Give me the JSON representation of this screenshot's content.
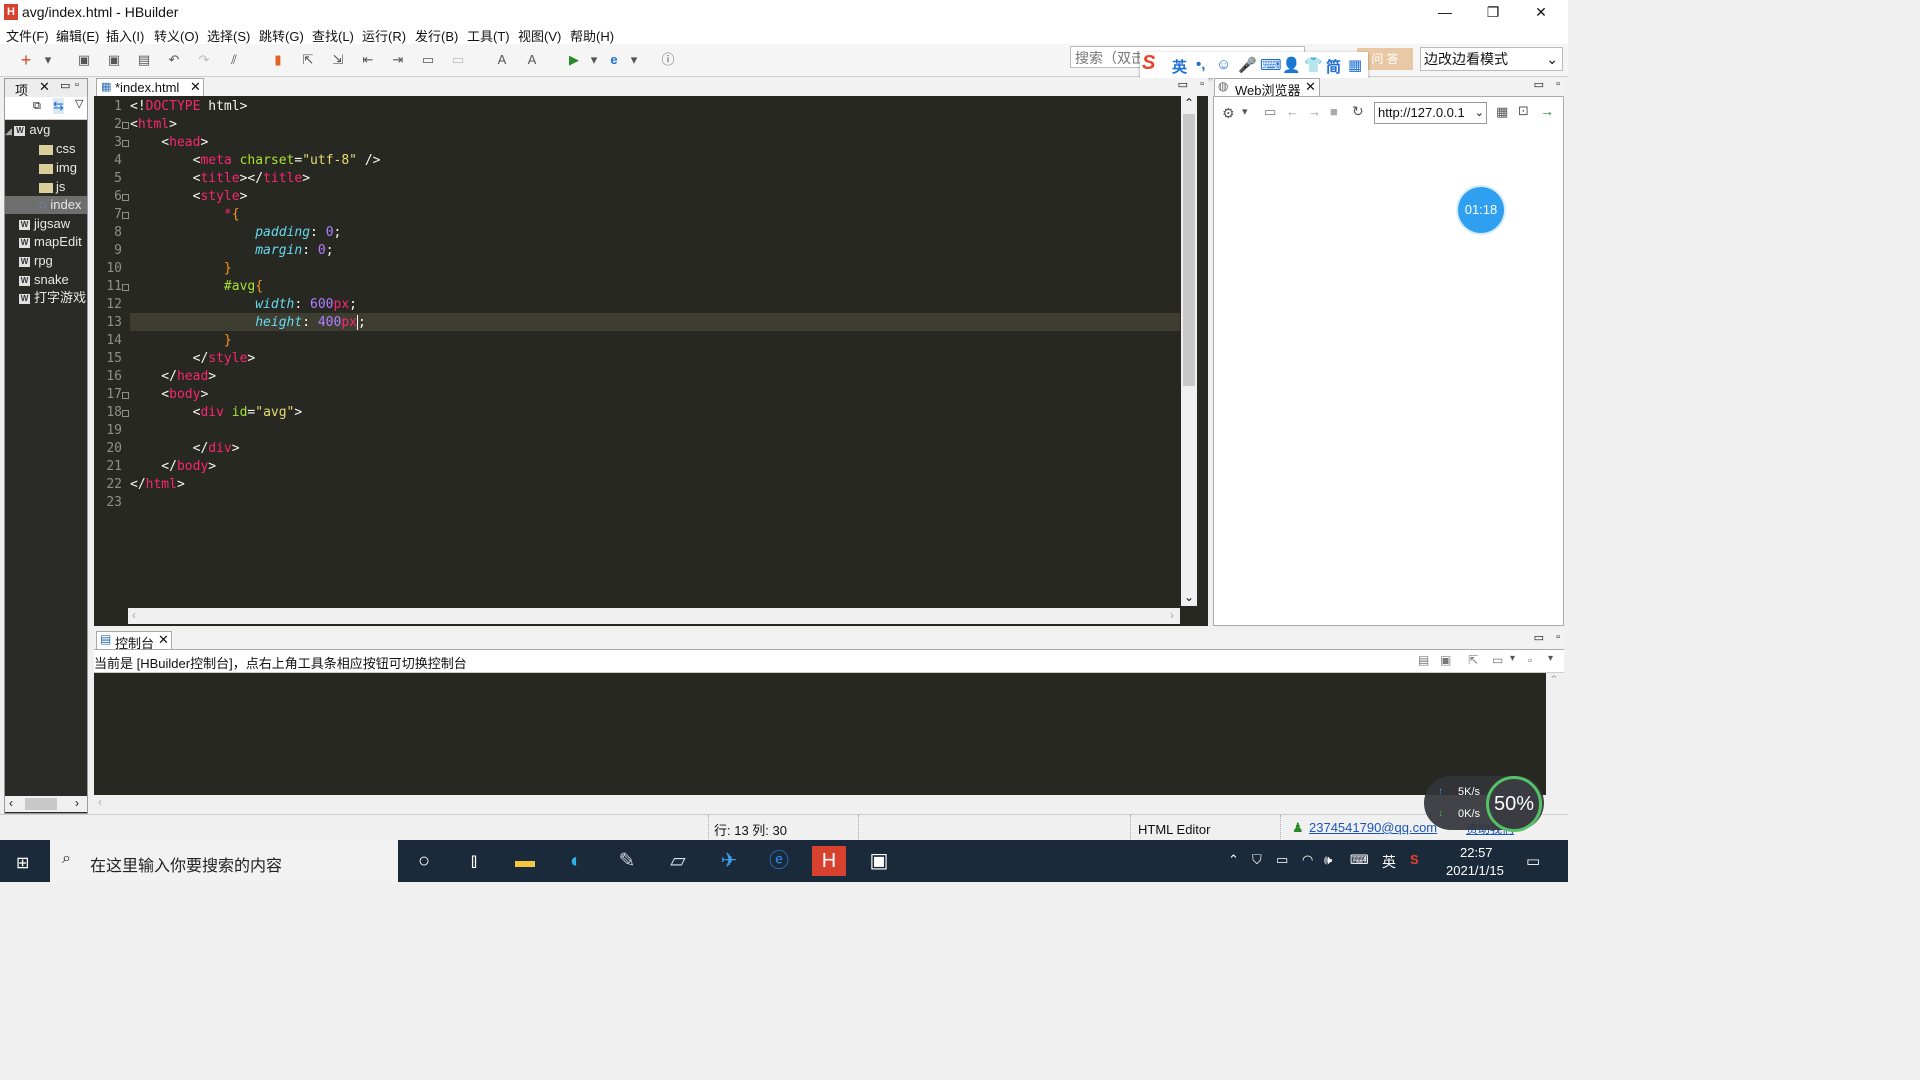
{
  "window": {
    "title": "avg/index.html  -  HBuilder",
    "app_icon": "H",
    "minimize_glyph": "—",
    "restore_glyph": "❐",
    "close_glyph": "✕"
  },
  "menu": [
    "文件(F)",
    "编辑(E)",
    "插入(I)",
    "转义(O)",
    "选择(S)",
    "跳转(G)",
    "查找(L)",
    "运行(R)",
    "发行(B)",
    "工具(T)",
    "视图(V)",
    "帮助(H)"
  ],
  "toolbar": {
    "search_placeholder": "搜索（双击",
    "ime": [
      "S",
      "英",
      "•,",
      "☺",
      "🎤",
      "⌨",
      "👤",
      "👕",
      "简",
      "▦"
    ],
    "help_label": "问 答",
    "mode": "边改边看模式"
  },
  "project": {
    "tab_label": "项",
    "tree": [
      {
        "label": "avg",
        "type": "project"
      },
      {
        "label": "css",
        "type": "folder"
      },
      {
        "label": "img",
        "type": "folder"
      },
      {
        "label": "js",
        "type": "folder"
      },
      {
        "label": "index",
        "type": "file",
        "selected": true
      },
      {
        "label": "jigsaw",
        "type": "project"
      },
      {
        "label": "mapEdit",
        "type": "project"
      },
      {
        "label": "rpg",
        "type": "project"
      },
      {
        "label": "snake",
        "type": "project"
      },
      {
        "label": "打字游戏",
        "type": "project"
      }
    ]
  },
  "editor": {
    "tab_label": "*index.html",
    "line_numbers": [
      "1",
      "2",
      "3",
      "4",
      "5",
      "6",
      "7",
      "8",
      "9",
      "10",
      "11",
      "12",
      "13",
      "14",
      "15",
      "16",
      "17",
      "18",
      "19",
      "20",
      "21",
      "22",
      "23"
    ],
    "current_line": 13
  },
  "browser": {
    "tab_label": "Web浏览器",
    "url": "http://127.0.0.1",
    "timer": "01:18"
  },
  "console": {
    "tab_label": "控制台",
    "info": "当前是 [HBuilder控制台]，点右上角工具条相应按钮可切换控制台"
  },
  "status": {
    "position": "行: 13 列: 30",
    "editor_type": "HTML Editor",
    "user": "2374541790@qq.com",
    "extra": "资助我们"
  },
  "speed_widget": {
    "up": "5K/s",
    "down": "0K/s",
    "percent": "50%"
  },
  "taskbar": {
    "search_placeholder": "在这里输入你要搜索的内容",
    "ime_lang": "英",
    "time": "22:57",
    "date": "2021/1/15"
  },
  "colors": {
    "editor_bg": "#272822",
    "tag": "#f92672",
    "attr": "#a6e22e",
    "string": "#e6db74",
    "number": "#ae81ff",
    "property": "#66d9ef",
    "taskbar": "#1b2a3a"
  }
}
